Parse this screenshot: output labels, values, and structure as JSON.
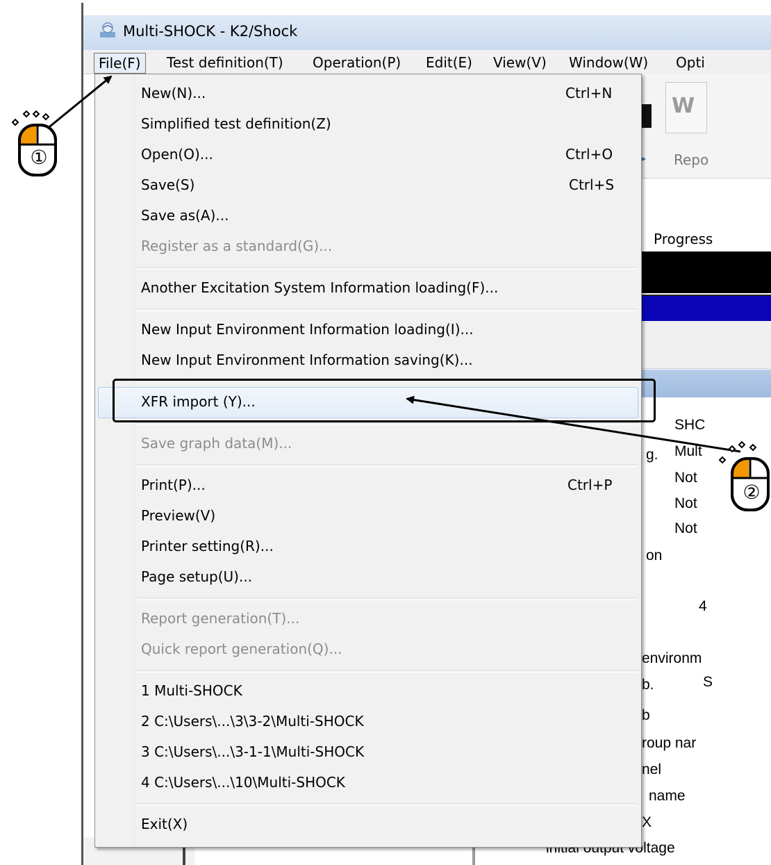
{
  "window": {
    "title": "Multi-SHOCK - K2/Shock"
  },
  "menubar": {
    "items": [
      "File(F)",
      "Test definition(T)",
      "Operation(P)",
      "Edit(E)",
      "View(V)",
      "Window(W)",
      "Opti"
    ]
  },
  "background": {
    "toolbar_icon_letter": "W",
    "report_label": "Repo",
    "progress_label": "Progress",
    "info_texts": [
      "SHC",
      "Mult",
      "g.",
      "Not",
      "Not",
      "Not",
      "on",
      "4",
      "environm",
      "b.",
      "S",
      "b",
      "roup nar",
      "nel",
      "name",
      "X",
      "initial output voltage"
    ]
  },
  "file_menu": {
    "items": [
      {
        "label": "New(N)...",
        "shortcut": "Ctrl+N",
        "enabled": true
      },
      {
        "label": "Simplified test definition(Z)",
        "shortcut": "",
        "enabled": true
      },
      {
        "label": "Open(O)...",
        "shortcut": "Ctrl+O",
        "enabled": true
      },
      {
        "label": "Save(S)",
        "shortcut": "Ctrl+S",
        "enabled": true
      },
      {
        "label": "Save as(A)...",
        "shortcut": "",
        "enabled": true
      },
      {
        "label": "Register as a standard(G)...",
        "shortcut": "",
        "enabled": false
      },
      {
        "label": "Another Excitation System Information loading(F)...",
        "shortcut": "",
        "enabled": true
      },
      {
        "label": "New Input Environment Information loading(I)...",
        "shortcut": "",
        "enabled": true
      },
      {
        "label": "New Input Environment Information saving(K)...",
        "shortcut": "",
        "enabled": true
      },
      {
        "label": "XFR import (Y)...",
        "shortcut": "",
        "enabled": true,
        "highlighted": true
      },
      {
        "label": "Save graph data(M)...",
        "shortcut": "",
        "enabled": false
      },
      {
        "label": "Print(P)...",
        "shortcut": "Ctrl+P",
        "enabled": true
      },
      {
        "label": "Preview(V)",
        "shortcut": "",
        "enabled": true
      },
      {
        "label": "Printer setting(R)...",
        "shortcut": "",
        "enabled": true
      },
      {
        "label": "Page setup(U)...",
        "shortcut": "",
        "enabled": true
      },
      {
        "label": "Report generation(T)...",
        "shortcut": "",
        "enabled": false
      },
      {
        "label": "Quick report generation(Q)...",
        "shortcut": "",
        "enabled": false
      },
      {
        "label": "1 Multi-SHOCK",
        "shortcut": "",
        "enabled": true
      },
      {
        "label": "2 C:\\Users\\...\\3\\3-2\\Multi-SHOCK",
        "shortcut": "",
        "enabled": true
      },
      {
        "label": "3 C:\\Users\\...\\3-1-1\\Multi-SHOCK",
        "shortcut": "",
        "enabled": true
      },
      {
        "label": "4 C:\\Users\\...\\10\\Multi-SHOCK",
        "shortcut": "",
        "enabled": true
      },
      {
        "label": "Exit(X)",
        "shortcut": "",
        "enabled": true
      }
    ]
  },
  "annotations": {
    "step1_label": "①",
    "step2_label": "②",
    "mouse_button_color": "#f39800"
  }
}
